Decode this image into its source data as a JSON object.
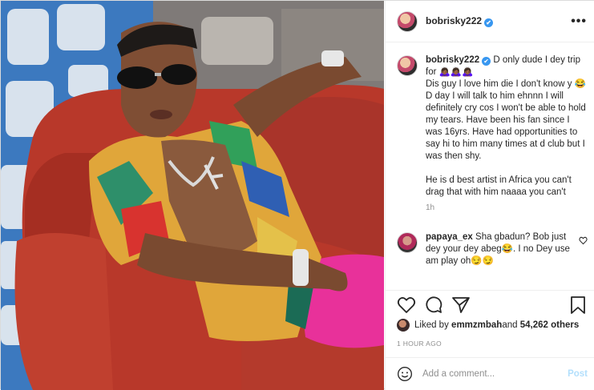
{
  "post": {
    "username": "bobrisky222",
    "verified_mark": "✔",
    "more_glyph": "•••"
  },
  "caption": {
    "username": "bobrisky222",
    "line1": " D only dude I dey trip for 🙇🏾‍♀️🙇🏾‍♀️🙇🏾‍♀️",
    "line2": "Dis guy I love him die I don't know y 😂",
    "line3": "D day I will talk to him ehnnn I will definitely cry cos I won't be able to hold my tears. Have been his fan since I was 16yrs. Have had opportunities to say hi to him many times at d club but I was then shy.",
    "line4": "He is d best artist in Africa you can't drag that with him naaaa you can't",
    "time": "1h"
  },
  "comment2": {
    "username": "papaya_ex",
    "text": " Sha gbadun? Bob just dey your dey abeg😂. I no Dey use am play oh😏😏"
  },
  "likes": {
    "prefix": "Liked by ",
    "user": "emmzmbah",
    "and": " and ",
    "count": "54,262 others"
  },
  "timestamp": "1 HOUR AGO",
  "add_comment": {
    "placeholder": "Add a comment...",
    "post_label": "Post"
  },
  "icons": {
    "like": "heart-icon",
    "comment": "comment-icon",
    "share": "share-icon",
    "save": "bookmark-icon",
    "emoji": "smiley-icon"
  }
}
